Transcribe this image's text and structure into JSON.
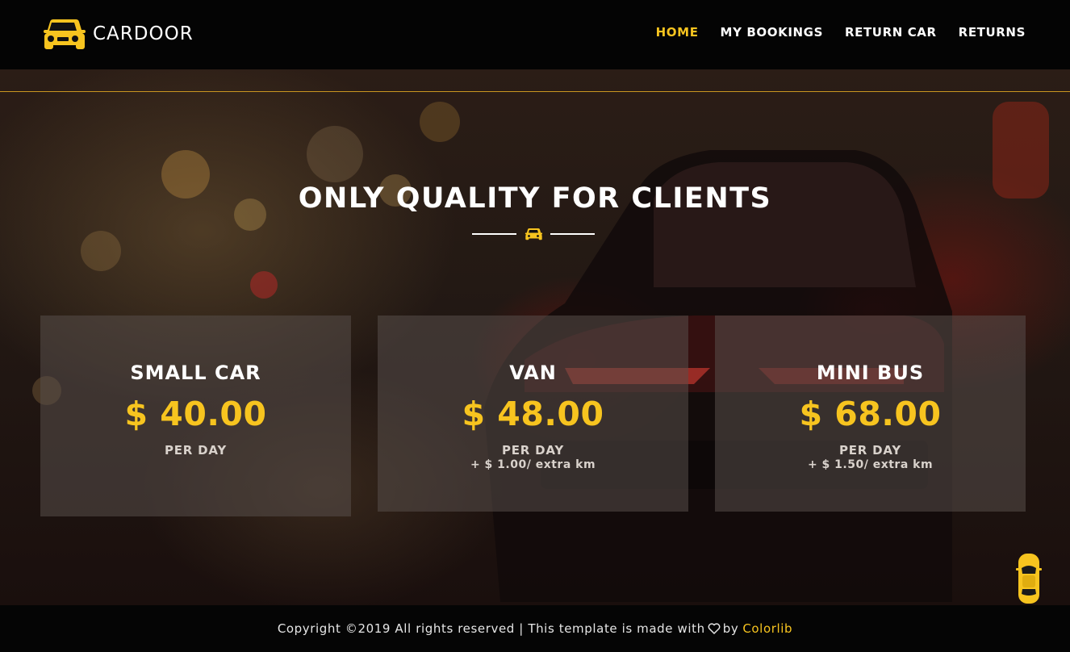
{
  "brand": {
    "name": "CARDOOR",
    "logo_icon": "car-front-icon"
  },
  "nav": {
    "items": [
      {
        "label": "HOME",
        "active": true
      },
      {
        "label": "MY BOOKINGS",
        "active": false
      },
      {
        "label": "RETURN CAR",
        "active": false
      },
      {
        "label": "RETURNS",
        "active": false
      }
    ]
  },
  "hero": {
    "title": "ONLY QUALITY FOR CLIENTS",
    "divider_icon": "car-icon"
  },
  "pricing": [
    {
      "name": "SMALL CAR",
      "price": "$ 40.00",
      "period": "PER DAY",
      "extra": ""
    },
    {
      "name": "VAN",
      "price": "$ 48.00",
      "period": "PER DAY",
      "extra": "+ $ 1.00/ extra km"
    },
    {
      "name": "MINI BUS",
      "price": "$ 68.00",
      "period": "PER DAY",
      "extra": "+ $ 1.50/ extra km"
    }
  ],
  "footer": {
    "copyright": "Copyright ©2019 All rights reserved | This template is made with",
    "heart_icon": "heart-icon",
    "by": "by",
    "credit": "Colorlib"
  },
  "scroll_top": {
    "icon": "car-top-view-icon"
  },
  "colors": {
    "accent": "#f7c41f",
    "navbar": "#040404",
    "card_bg": "rgba(88,78,74,0.55)",
    "text": "#ffffff"
  }
}
